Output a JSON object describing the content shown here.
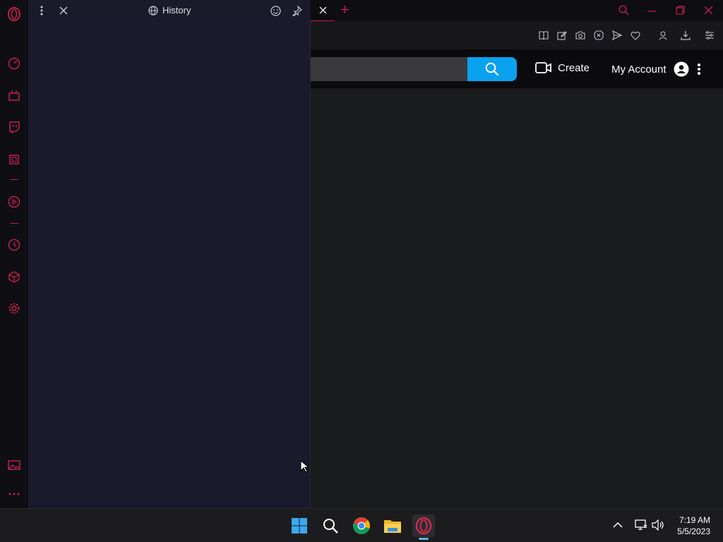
{
  "panel": {
    "title": "History"
  },
  "site": {
    "search_placeholder": "",
    "create_label": "Create",
    "account_label": "My Account"
  },
  "taskbar": {
    "time": "7:19 AM",
    "date": "5/5/2023"
  },
  "colors": {
    "accent": "#c3204d",
    "search_button": "#0aa2ef",
    "panel_bg": "#1b1a2d",
    "content_bg": "#1a1b1d"
  }
}
